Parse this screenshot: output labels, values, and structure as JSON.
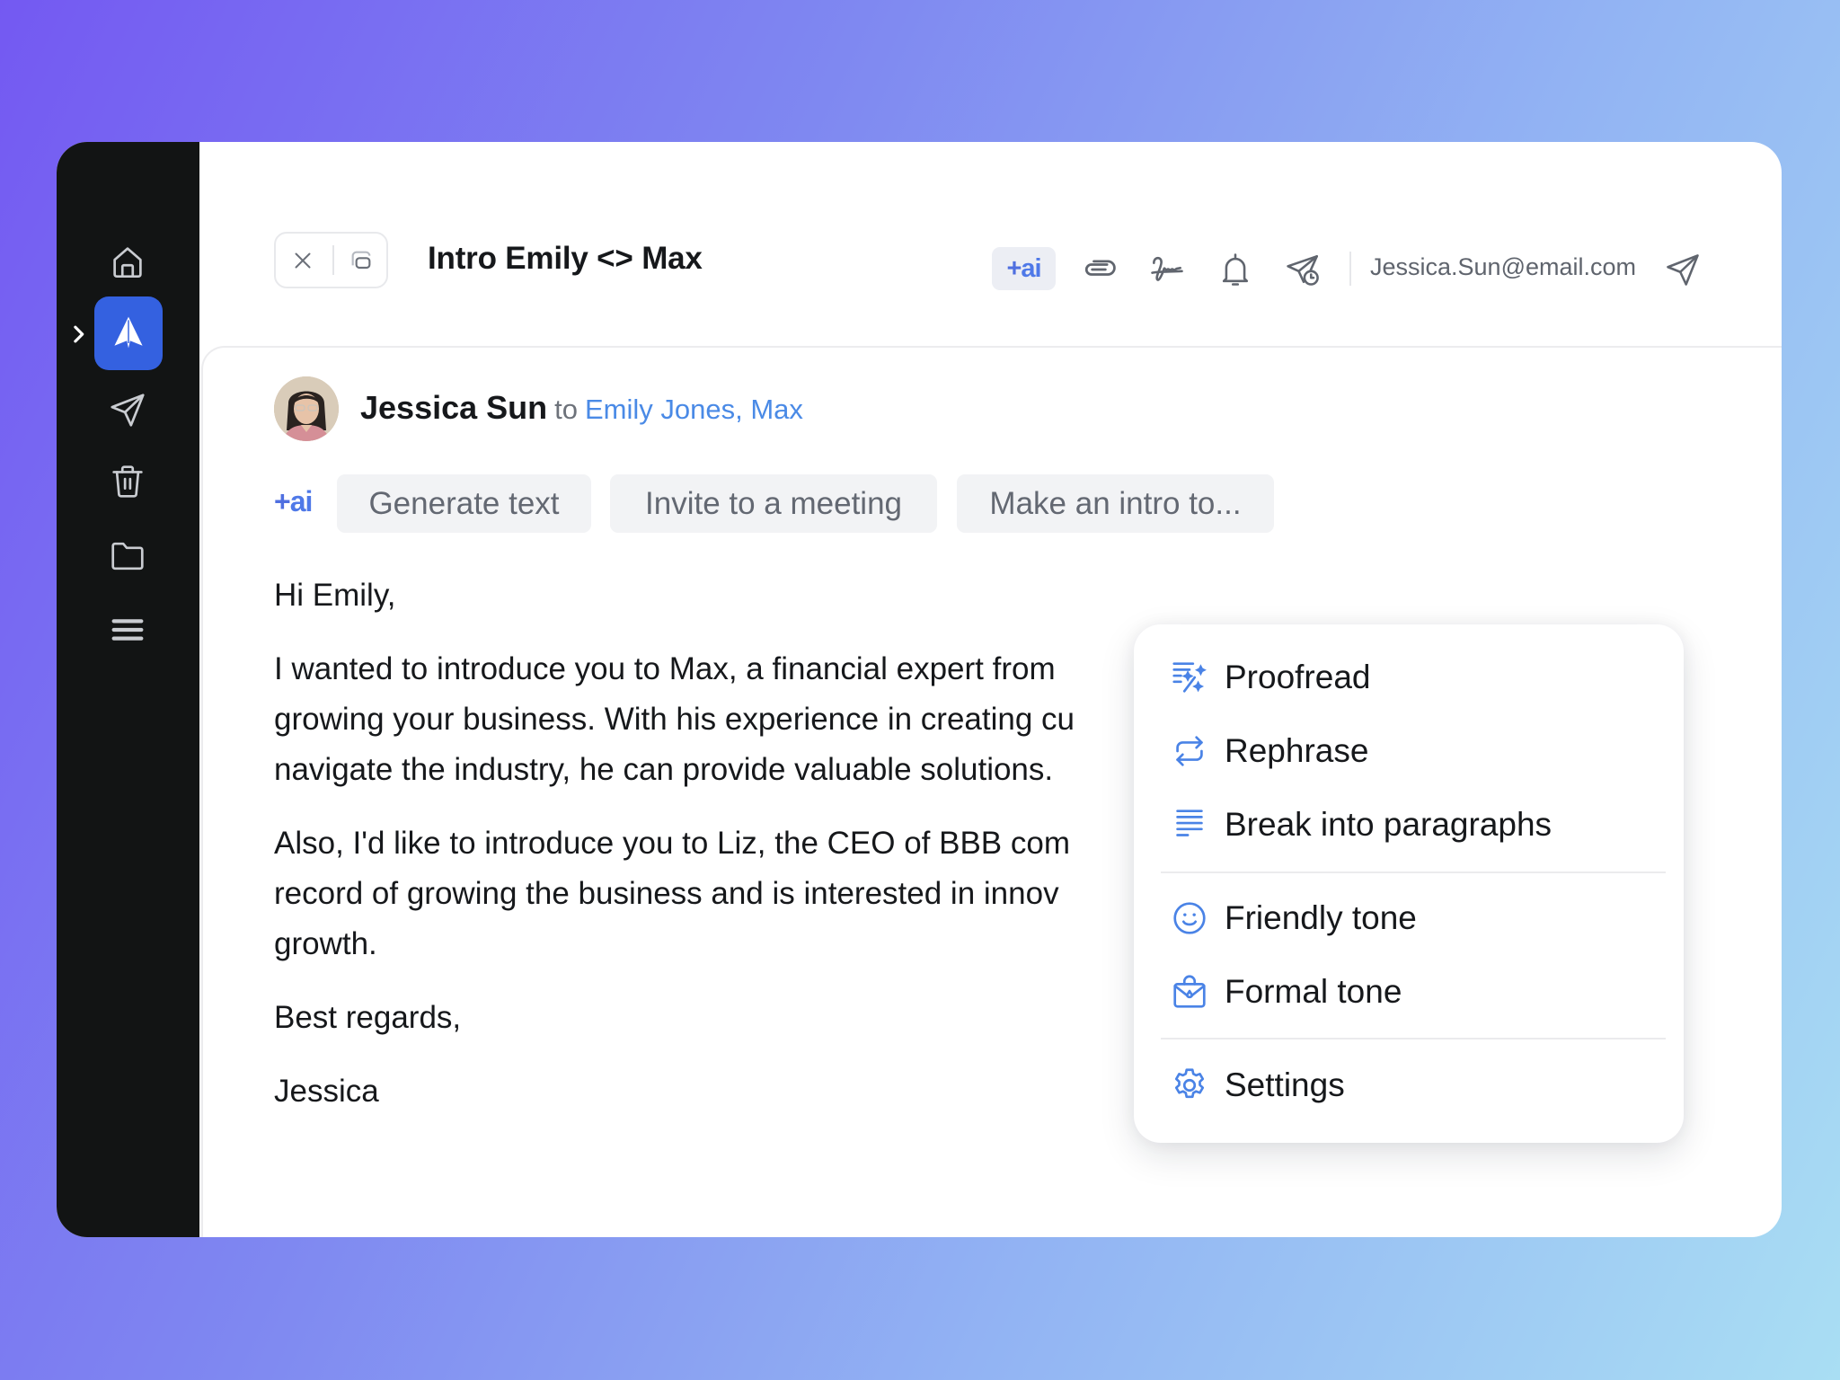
{
  "sidebar": {
    "items": [
      {
        "name": "home",
        "icon": "home-icon",
        "active": false
      },
      {
        "name": "compose",
        "icon": "spark-logo-icon",
        "active": true
      },
      {
        "name": "sent",
        "icon": "send-icon",
        "active": false
      },
      {
        "name": "trash",
        "icon": "trash-icon",
        "active": false
      },
      {
        "name": "folders",
        "icon": "folder-icon",
        "active": false
      },
      {
        "name": "more",
        "icon": "menu-icon",
        "active": false
      }
    ],
    "active_color": "#3461e0",
    "expand_icon": "chevron-right-icon"
  },
  "header": {
    "title": "Intro Emily <> Max",
    "ai_badge": {
      "plus": "+",
      "label": "ai"
    },
    "toolbar_icons": [
      "paperclip-icon",
      "signature-icon",
      "bell-icon",
      "send-later-icon"
    ],
    "from_email": "Jessica.Sun@email.com",
    "send_icon": "send-icon"
  },
  "message": {
    "sender": "Jessica Sun",
    "to_label": "to",
    "recipients": "Emily Jones, Max",
    "ai_prefix": {
      "plus": "+",
      "label": "ai"
    },
    "ai_actions": [
      "Generate text",
      "Invite to a meeting",
      "Make an intro to..."
    ],
    "body": [
      "Hi Emily,",
      "I wanted to introduce you to Max, a financial expert from",
      "growing your business. With his experience in creating cu",
      "navigate the industry, he can provide valuable solutions.",
      "Also, I'd like to introduce you to Liz, the CEO of BBB com",
      "record of growing the business and is interested in innov",
      "growth.",
      "Best regards,",
      "Jessica"
    ]
  },
  "ai_menu": {
    "accent_color": "#4a83e6",
    "groups": [
      [
        {
          "label": "Proofread",
          "icon": "magic-wand-text-icon"
        },
        {
          "label": "Rephrase",
          "icon": "repeat-icon"
        },
        {
          "label": "Break into paragraphs",
          "icon": "paragraph-lines-icon"
        }
      ],
      [
        {
          "label": "Friendly tone",
          "icon": "smiley-icon"
        },
        {
          "label": "Formal tone",
          "icon": "briefcase-envelope-icon"
        }
      ],
      [
        {
          "label": "Settings",
          "icon": "gear-icon"
        }
      ]
    ]
  }
}
